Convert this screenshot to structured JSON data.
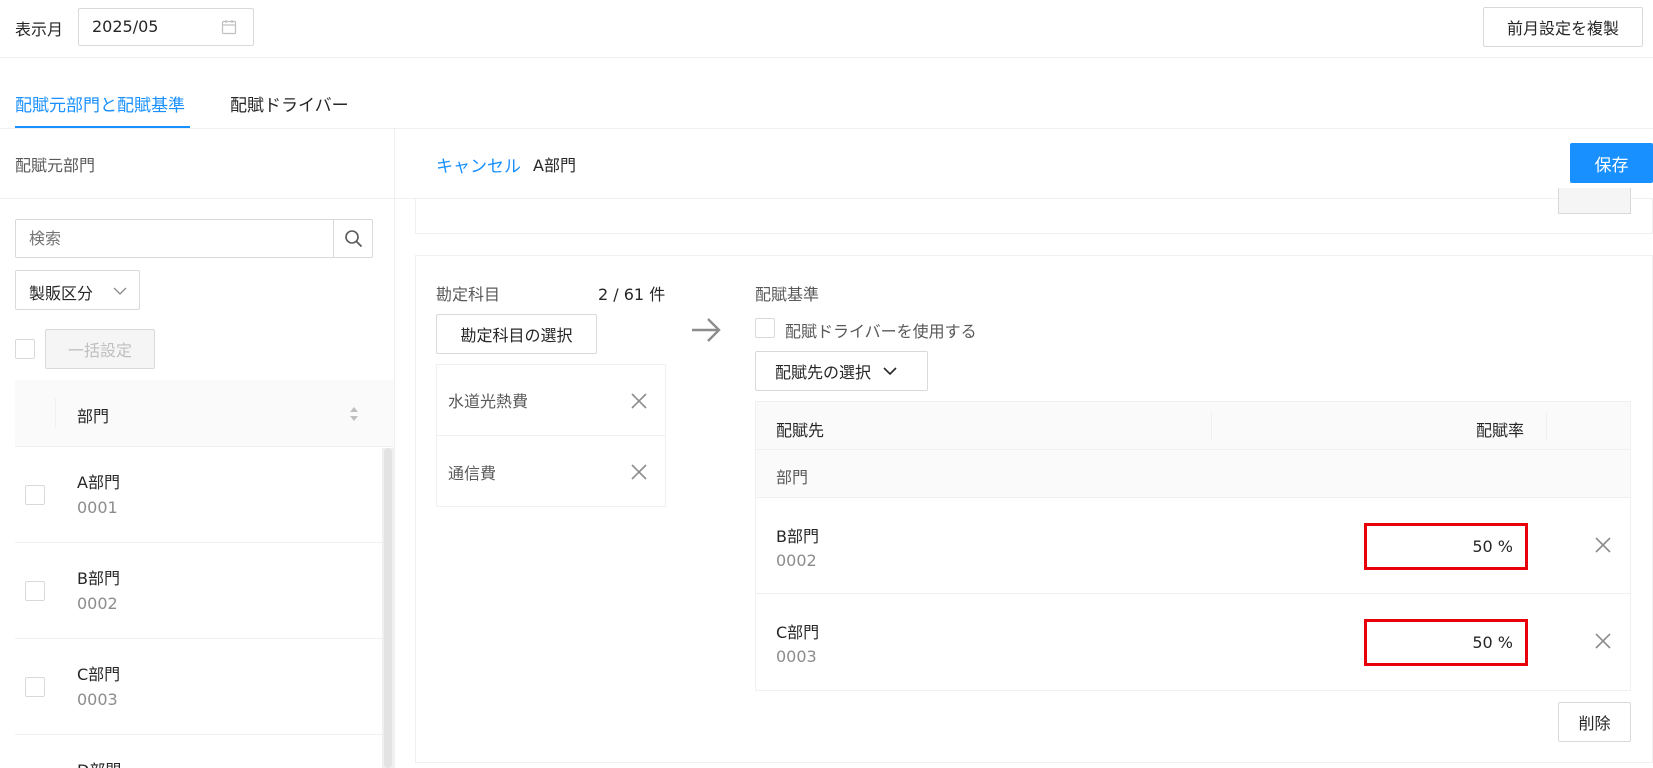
{
  "header": {
    "month_label": "表示月",
    "month_value": "2025/05",
    "copy_button": "前月設定を複製"
  },
  "tabs": [
    {
      "label": "配賦元部門と配賦基準",
      "active": true
    },
    {
      "label": "配賦ドライバー",
      "active": false
    }
  ],
  "left_panel": {
    "title": "配賦元部門",
    "search_placeholder": "検索",
    "filter_select": "製販区分",
    "bulk_button": "一括設定",
    "column_header": "部門",
    "rows": [
      {
        "name": "A部門",
        "code": "0001"
      },
      {
        "name": "B部門",
        "code": "0002"
      },
      {
        "name": "C部門",
        "code": "0003"
      },
      {
        "name": "D部門",
        "code": ""
      }
    ]
  },
  "right_panel": {
    "cancel_link": "キャンセル",
    "current_dept": "A部門",
    "save_button": "保存",
    "account": {
      "label": "勘定科目",
      "count": "2 / 61 件",
      "select_button": "勘定科目の選択",
      "items": [
        "水道光熱費",
        "通信費"
      ]
    },
    "allocation": {
      "label": "配賦基準",
      "use_driver_label": "配賦ドライバーを使用する",
      "select_target_button": "配賦先の選択",
      "col_target": "配賦先",
      "col_rate": "配賦率",
      "group_label": "部門",
      "rows": [
        {
          "name": "B部門",
          "code": "0002",
          "rate": "50 %"
        },
        {
          "name": "C部門",
          "code": "0003",
          "rate": "50 %"
        }
      ],
      "delete_button": "削除"
    }
  },
  "colors": {
    "primary": "#1890ff",
    "highlight": "#e8000b"
  }
}
